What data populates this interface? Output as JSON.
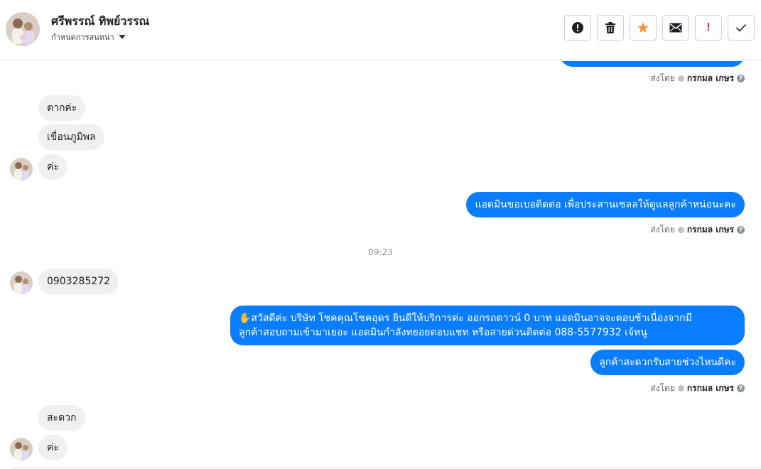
{
  "header": {
    "name": "ศรีพรรณ์ ทิพย์วรรณ",
    "subtitle": "กำหนดการสนทนา"
  },
  "toolbar": {
    "buttons": [
      {
        "icon": "alert-circle-icon"
      },
      {
        "icon": "trash-icon"
      },
      {
        "icon": "star-icon",
        "color": "#f7923b"
      },
      {
        "icon": "envelope-icon"
      },
      {
        "icon": "exclamation-icon",
        "label": "!",
        "color": "#e4222e"
      },
      {
        "icon": "check-icon"
      }
    ]
  },
  "sent_by": {
    "prefix": "ส่งโดย",
    "agent": "กรกมล เกษร",
    "help": "?"
  },
  "messages": {
    "m1": "ตากค่ะ",
    "m2": "เขื่อนภูมิพล",
    "m3": "ค่ะ",
    "m4": "แอดมินขอเบอติดต่อ เพื่อประสานเซลลให้ดูแลลูกค้าหน่อนะคะ",
    "time": "09:23",
    "m5": "0903285272",
    "m6_line1": "✋สวัสดีค่ะ บริษัท โชคคุณโชคอุดร ยินดีให้บริการค่ะ ออกรถดาวน์ 0 บาท แอดมินอาจจะตอบช้าเนื่องจากมี",
    "m6_line2": "ลูกค้าสอบถามเข้ามาเยอะ แอดมินกำลังทยอยตอบแชท หรือสายด่วนติดต่อ 088-5577932 เจ้หนู",
    "m7": "ลูกค้าสะดวกรับสายช่วงไหนดีคะ",
    "m8": "สะดวก",
    "m9": "ค่ะ"
  },
  "colors": {
    "outgoing_bubble": "#0a7cff",
    "incoming_bubble": "#f0f0f0"
  }
}
